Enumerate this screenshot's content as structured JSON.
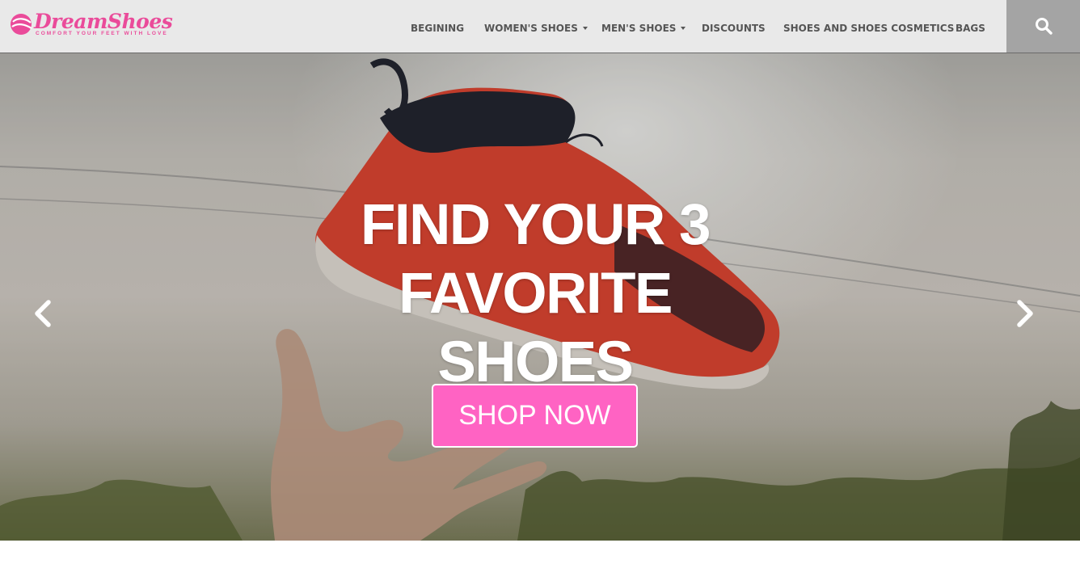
{
  "brand": {
    "name": "DreamShoes",
    "tagline": "COMFORT YOUR FEET WITH LOVE",
    "color": "#ea4b9a"
  },
  "nav": {
    "items": [
      {
        "label": "BEGINING",
        "has_dropdown": false
      },
      {
        "label": "WOMEN'S SHOES",
        "has_dropdown": true
      },
      {
        "label": "MEN'S SHOES",
        "has_dropdown": true
      },
      {
        "label": "DISCOUNTS",
        "has_dropdown": false
      },
      {
        "label": "SHOES AND SHOES COSMETICS",
        "has_dropdown": false
      },
      {
        "label": "BAGS",
        "has_dropdown": false
      }
    ],
    "search_icon": "search-icon"
  },
  "hero": {
    "headline_lines": [
      "FIND YOUR 3",
      "FAVORITE",
      "SHOES"
    ],
    "cta_label": "SHOP NOW",
    "cta_color": "#ff63c3",
    "prev_icon": "chevron-left-icon",
    "next_icon": "chevron-right-icon"
  }
}
